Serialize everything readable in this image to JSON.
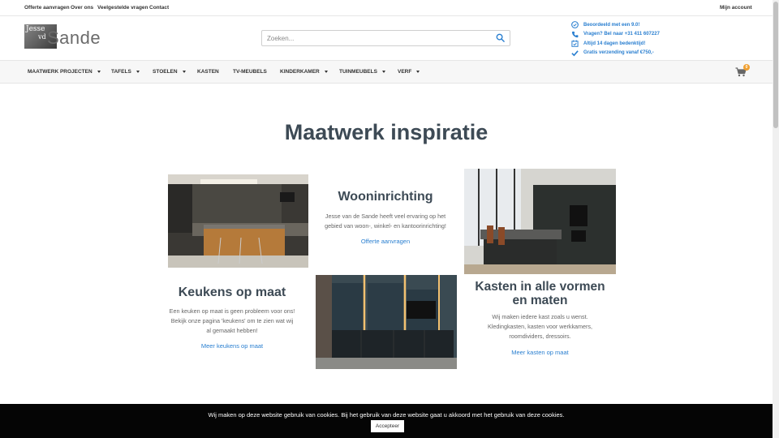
{
  "topbar": {
    "links": [
      "Offerte aanvragen",
      "Over ons",
      "Veelgestelde vragen",
      "Contact"
    ],
    "account": "Mijn account"
  },
  "logo": {
    "line1": "Jesse",
    "line2": "vd",
    "brand": "Sande"
  },
  "search": {
    "placeholder": "Zoeken..."
  },
  "usps": [
    {
      "icon": "rating-icon",
      "text": "Beoordeeld met een 9.0!"
    },
    {
      "icon": "phone-icon",
      "text": "Vragen? Bel naar +31 411 607227"
    },
    {
      "icon": "calendar-check-icon",
      "text": "Altijd 14 dagen bedenktijd!"
    },
    {
      "icon": "check-icon",
      "text": "Gratis verzending vanaf €750,-"
    }
  ],
  "nav": {
    "items": [
      {
        "label": "Maatwerk projecten",
        "dropdown": true
      },
      {
        "label": "Tafels",
        "dropdown": true
      },
      {
        "label": "Stoelen",
        "dropdown": true
      },
      {
        "label": "Kasten",
        "dropdown": false
      },
      {
        "label": "TV-meubels",
        "dropdown": false
      },
      {
        "label": "Kinderkamer",
        "dropdown": true
      },
      {
        "label": "Tuinmeubels",
        "dropdown": true
      },
      {
        "label": "Verf",
        "dropdown": true
      }
    ],
    "cart_count": "0"
  },
  "main": {
    "title": "Maatwerk inspiratie",
    "wooninrichting": {
      "title": "Wooninrichting",
      "text_lines": [
        "Jesse van de Sande heeft veel ervaring op het",
        "gebied van woon-, winkel- en kantoorinrichting!"
      ],
      "link": "Offerte aanvragen"
    },
    "keukens": {
      "title": "Keukens op maat",
      "text_lines": [
        "Een keuken op maat is geen probleem voor ons!",
        "Bekijk onze pagina 'keukens' om te zien wat wij",
        "al gemaakt hebben!"
      ],
      "link": "Meer keukens op maat"
    },
    "kasten": {
      "title_lines": [
        "Kasten in alle vormen",
        "en maten"
      ],
      "text_lines": [
        "Wij maken iedere kast zoals u wenst.",
        "Kledingkasten, kasten voor werkkamers,",
        "roomdividers, dressoirs."
      ],
      "link": "Meer kasten op maat"
    }
  },
  "cookie": {
    "text": "Wij maken op deze website gebruik van cookies. Bij het gebruik van deze website gaat u akkoord met het gebruik van deze cookies.",
    "button": "Accepteer"
  },
  "colors": {
    "accent": "#2a7fd0",
    "heading": "#3d4a55",
    "badge": "#f0a030"
  }
}
